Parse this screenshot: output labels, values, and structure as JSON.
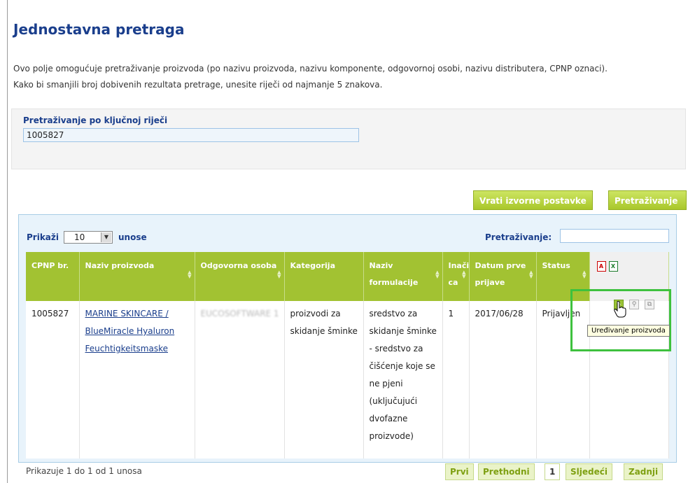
{
  "page": {
    "title": "Jednostavna pretraga",
    "intro_line1": "Ovo polje omogućuje pretraživanje proizvoda (po nazivu proizvoda, nazivu komponente, odgovornoj osobi, nazivu distributera, CPNP oznaci).",
    "intro_line2": "Kako bi smanjili broj dobivenih rezultata pretrage, unesite riječi od najmanje 5 znakova."
  },
  "search": {
    "label": "Pretraživanje po ključnoj riječi",
    "value": "1005827"
  },
  "buttons": {
    "reset": "Vrati izvorne postavke",
    "search": "Pretraživanje"
  },
  "table_controls": {
    "show_label": "Prikaži",
    "show_value": "10",
    "show_suffix": "unose",
    "filter_label": "Pretraživanje:",
    "filter_value": ""
  },
  "columns": [
    {
      "label": "CPNP br."
    },
    {
      "label": "Naziv proizvoda"
    },
    {
      "label": "Odgovorna osoba"
    },
    {
      "label": "Kategorija"
    },
    {
      "label": "Naziv formulacije"
    },
    {
      "label": "Inači ca"
    },
    {
      "label": "Datum prve prijave"
    },
    {
      "label": "Status"
    }
  ],
  "rows": [
    {
      "cpnp": "1005827",
      "product_name": "MARINE SKINCARE / BlueMiracle Hyaluron Feuchtigkeitsmaske",
      "responsible_person": "EUCOSOFTWARE 1",
      "category": "proizvodi za skidanje šminke",
      "formulation": "sredstvo za skidanje šminke - sredstvo za čišćenje koje se ne pjeni (uključujući dvofazne proizvode)",
      "variant": "1",
      "first_notification_date": "2017/06/28",
      "status": "Prijavljen"
    }
  ],
  "export_icons": [
    "pdf-icon",
    "excel-icon"
  ],
  "row_action_icons": [
    "edit-pencil-icon",
    "view-magnifier-icon",
    "copy-icon"
  ],
  "tooltip": "Uređivanje proizvoda",
  "pagination": {
    "info": "Prikazuje 1 do 1 od 1 unosa",
    "first": "Prvi",
    "previous": "Prethodni",
    "current": "1",
    "next": "Sljedeći",
    "last": "Zadnji"
  },
  "colors": {
    "title_blue": "#1a3e8c",
    "header_green": "#a2c232",
    "highlight_green": "#3ec13e"
  }
}
